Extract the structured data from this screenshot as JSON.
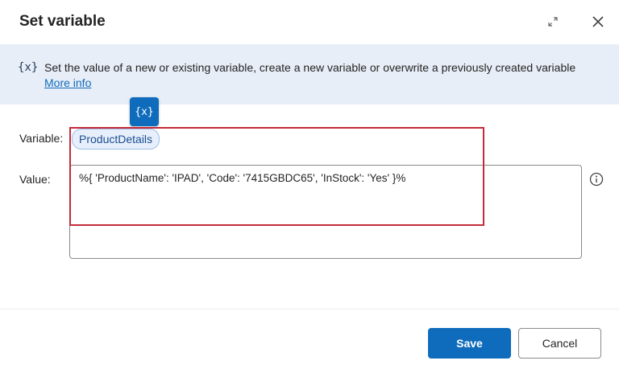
{
  "dialog": {
    "title": "Set variable"
  },
  "info": {
    "icon_text": "{x}",
    "description": "Set the value of a new or existing variable, create a new variable or overwrite a previously created variable",
    "more_info_link": "More info"
  },
  "variable_picker": {
    "icon_text": "{x}"
  },
  "fields": {
    "variable_label": "Variable:",
    "variable_value": "ProductDetails",
    "value_label": "Value:",
    "value_text": "%{ 'ProductName': 'IPAD', 'Code': '7415GBDC65', 'InStock': 'Yes' }%"
  },
  "footer": {
    "save_label": "Save",
    "cancel_label": "Cancel"
  },
  "colors": {
    "accent": "#0f6cbd",
    "info_bar": "#e8eef7",
    "highlight": "#c42b3a"
  },
  "icons": {
    "expand": "expand-icon",
    "close": "close-icon",
    "help": "info-circle-icon"
  }
}
